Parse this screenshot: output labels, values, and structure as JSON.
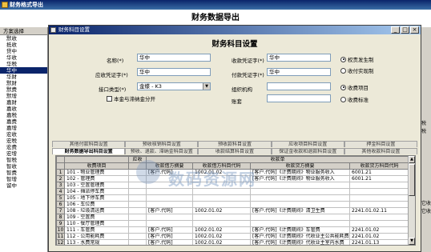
{
  "outer": {
    "title": "财务格式导出",
    "heading": "财务数据导出"
  },
  "scheme": {
    "header": "方案选择",
    "items": [
      "默收",
      "抵收",
      "贷中",
      "华收",
      "华税",
      "华中",
      "华财",
      "默财",
      "默费",
      "默增",
      "嘉财",
      "嘉收",
      "嘉税",
      "嘉费",
      "嘉增",
      "宏收",
      "宏税",
      "宏费",
      "宏增",
      "智税",
      "智收",
      "智费",
      "智增",
      "留中"
    ],
    "selected_index": 5
  },
  "right_stubs": [
    "税",
    "税",
    "它收",
    "它收"
  ],
  "dialog": {
    "title": "财务科目设置",
    "heading": "财务科目设置",
    "name_label": "名称(*)",
    "name_value": "华中",
    "ar_voucher_label": "应收凭证字(*)",
    "ar_voucher_value": "华中",
    "interface_label": "接口类型(*)",
    "interface_value": "金蝶 - K3",
    "checkbox_label": "本金与滞纳金分开",
    "ar_voucher2_label": "收款凭证字(*)",
    "ar_voucher2_value": "华中",
    "ap_voucher_label": "付款凭证字(*)",
    "ap_voucher_value": "华中",
    "org_label": "组织机构",
    "org_value": "",
    "account_label": "账套",
    "account_value": "",
    "radios_a": [
      {
        "label": "权责发生制",
        "on": true
      },
      {
        "label": "收付实现制",
        "on": false
      }
    ],
    "radios_b": [
      {
        "label": "收费项目",
        "on": true
      },
      {
        "label": "收费标准",
        "on": false
      }
    ]
  },
  "tabs": {
    "row1": [
      "其他付款科目设置",
      "预收核销科目设置",
      "预收款科目设置",
      "应收项目科目设置",
      "押金科目设置"
    ],
    "row2": [
      "财务数据导出科目设置",
      "预收、退款、滞纳金科目设置",
      "收款结算科目设置",
      "保证金收款和退款科目设置",
      "其他收款科目设置"
    ],
    "active_row2": 0
  },
  "grid": {
    "header_top": {
      "col1": "",
      "col2": "应收",
      "col3": "收款单"
    },
    "headers": [
      "收费项目",
      "",
      "收款借方摘要",
      "收款借方科目代码",
      "收款贷方摘要",
      "收款贷方科目代码"
    ],
    "rows": [
      {
        "idx": "1",
        "item": "101 - 物业管理费",
        "s": "",
        "dsum": "[客户.代码]",
        "dcode": "1002.01.02",
        "csum": "[客户.代码]《计费期间》物业服务收入",
        "ccode": "6001.21"
      },
      {
        "idx": "2",
        "item": "102 - 管理费",
        "s": "",
        "dsum": "",
        "dcode": "",
        "csum": "[客户.代码]《计费期间》物业服务收入",
        "ccode": "6001.21"
      },
      {
        "idx": "3",
        "item": "103 - 空置管理费",
        "s": "",
        "dsum": "",
        "dcode": "",
        "csum": "",
        "ccode": ""
      },
      {
        "idx": "4",
        "item": "104 - 摊派停车费",
        "s": "",
        "dsum": "",
        "dcode": "",
        "csum": "",
        "ccode": ""
      },
      {
        "idx": "5",
        "item": "105 - 地下停车费",
        "s": "",
        "dsum": "",
        "dcode": "",
        "csum": "",
        "ccode": ""
      },
      {
        "idx": "6",
        "item": "106 - 车位费",
        "s": "",
        "dsum": "",
        "dcode": "",
        "csum": "",
        "ccode": ""
      },
      {
        "idx": "7",
        "item": "108 - 垃圾清运费",
        "s": "",
        "dsum": "[客户.代码]",
        "dcode": "1002.01.02",
        "csum": "[客户.代码]《计费期间》清卫生费",
        "ccode": "2241.01.02.11"
      },
      {
        "idx": "8",
        "item": "109 - 空置费",
        "s": "",
        "dsum": "",
        "dcode": "",
        "csum": "",
        "ccode": ""
      },
      {
        "idx": "9",
        "item": "110 - 餐厅管理费",
        "s": "",
        "dsum": "",
        "dcode": "",
        "csum": "",
        "ccode": ""
      },
      {
        "idx": "10",
        "item": "111 - 车管费",
        "s": "",
        "dsum": "[客户.代码]",
        "dcode": "1002.01.02",
        "csum": "[客户.代码]《计费期间》车管费",
        "ccode": "2241.01.02"
      },
      {
        "idx": "11",
        "item": "112 - 公用能耗费",
        "s": "",
        "dsum": "[客户.代码]",
        "dcode": "1002.01.02",
        "csum": "[客户.代码]《计费期间》代收业主公共能耗费",
        "ccode": "2241.01.02"
      },
      {
        "idx": "12",
        "item": "113 - 水费常规",
        "s": "",
        "dsum": "[客户.代码]",
        "dcode": "1002.01.02",
        "csum": "[客户.代码]《计费期间》代收业主室内水费",
        "ccode": "2241.01.13"
      },
      {
        "idx": "13",
        "item": "114 - 消防检测费",
        "s": "",
        "dsum": "[客户.代码]",
        "dcode": "1002.01.02",
        "csum": "[客户.代码]《计费期间》保安费",
        "ccode": "2241.01.02"
      }
    ]
  },
  "watermark": "数码资源网"
}
